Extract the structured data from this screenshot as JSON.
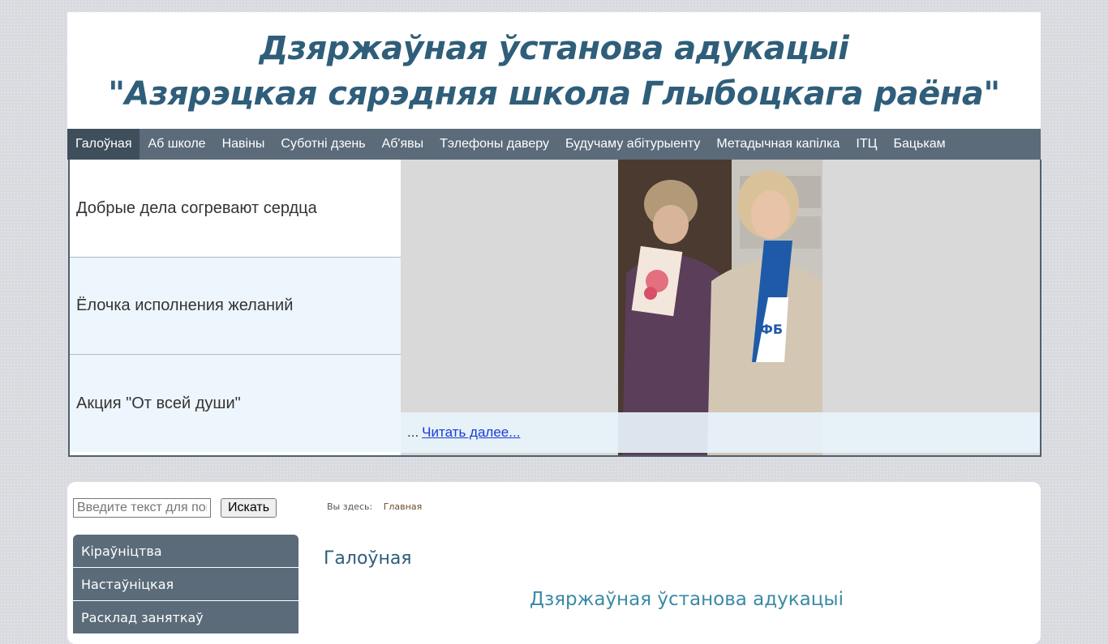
{
  "header": {
    "line1": "Дзяржаўная ўстанова адукацыі",
    "line2": "\"Азярэцкая сярэдняя школа Глыбоцкага раёна\""
  },
  "nav": [
    {
      "label": "Галоўная",
      "active": true
    },
    {
      "label": "Аб школе"
    },
    {
      "label": "Навіны"
    },
    {
      "label": "Суботні дзень"
    },
    {
      "label": "Аб'явы"
    },
    {
      "label": "Тэлефоны даверу"
    },
    {
      "label": "Будучаму абітурыенту"
    },
    {
      "label": "Метадычная капілка"
    },
    {
      "label": "ІТЦ"
    },
    {
      "label": "Бацькам"
    }
  ],
  "slider": {
    "items": [
      {
        "label": "Добрые дела согревают сердца"
      },
      {
        "label": "Ёлочка исполнения желаний"
      },
      {
        "label": "Акция \"От всей души\""
      }
    ],
    "caption_prefix": "...",
    "read_more": "Читать далее..."
  },
  "search": {
    "placeholder": "Введите текст для поиска...",
    "button": "Искать"
  },
  "side_menu": [
    "Кіраўніцтва",
    "Настаўніцкая",
    "Расклад заняткаў"
  ],
  "breadcrumb": {
    "label": "Вы здесь:",
    "current": "Главная"
  },
  "main": {
    "title": "Галоўная",
    "subtitle": "Дзяржаўная ўстанова адукацыі"
  },
  "colors": {
    "nav_bg": "#5b6b79",
    "nav_active": "#3f4e5b",
    "title": "#2f5e7a",
    "slider_inactive": "#eef6fd"
  }
}
